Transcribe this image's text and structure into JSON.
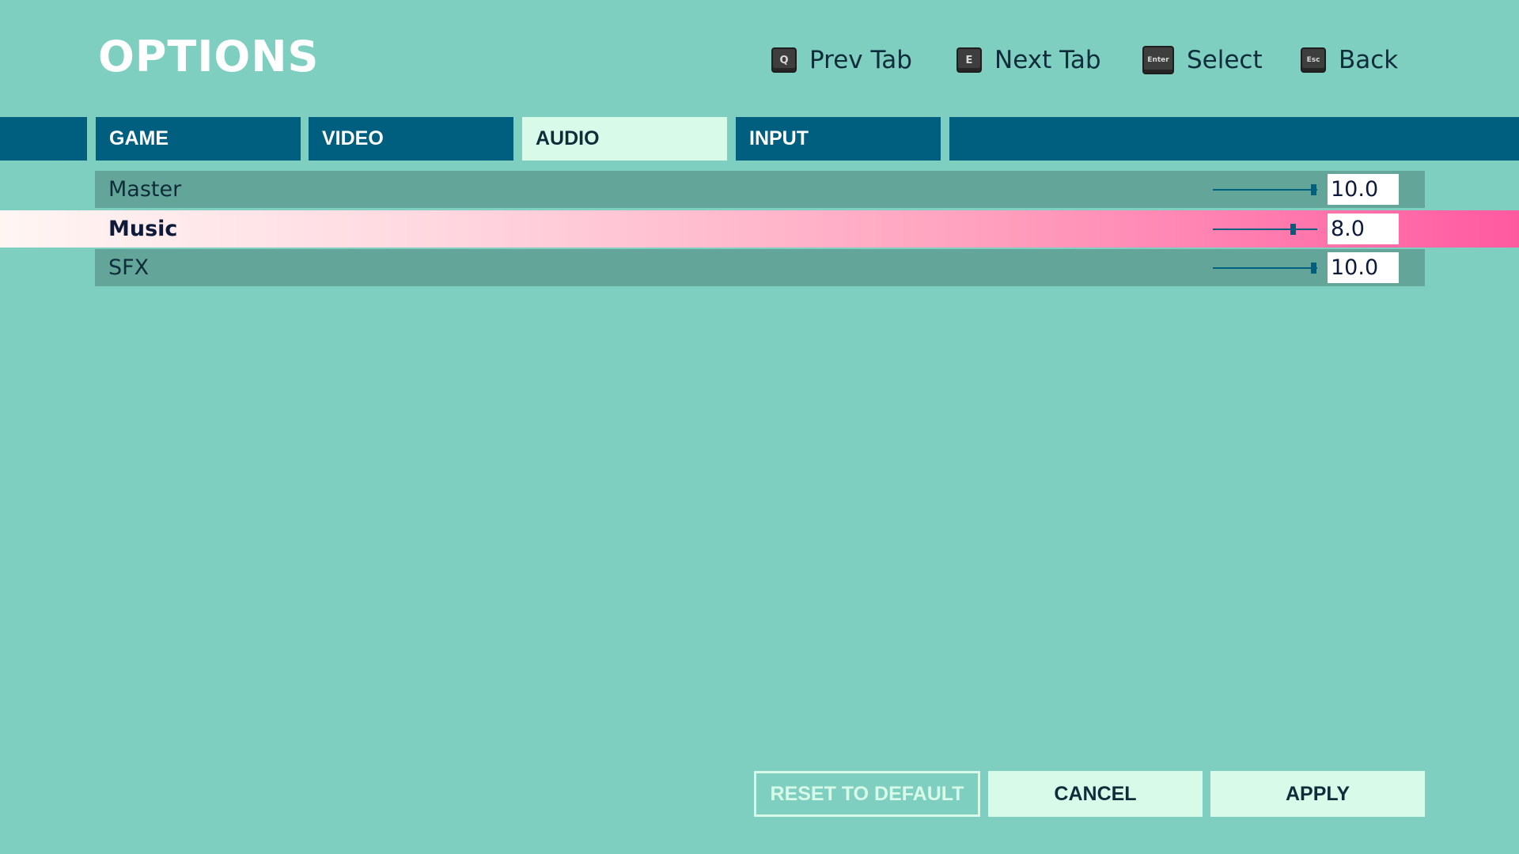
{
  "header": {
    "title": "OPTIONS"
  },
  "hints": [
    {
      "key": "Q",
      "label": "Prev Tab",
      "icon": "q-key-icon"
    },
    {
      "key": "E",
      "label": "Next Tab",
      "icon": "e-key-icon"
    },
    {
      "key": "Enter",
      "label": "Select",
      "icon": "enter-key-icon"
    },
    {
      "key": "Esc",
      "label": "Back",
      "icon": "esc-key-icon"
    }
  ],
  "tabs": [
    {
      "label": "GAME",
      "active": false
    },
    {
      "label": "VIDEO",
      "active": false
    },
    {
      "label": "AUDIO",
      "active": true
    },
    {
      "label": "INPUT",
      "active": false
    }
  ],
  "settings": [
    {
      "label": "Master",
      "value": "10.0",
      "level": 1.0,
      "selected": false
    },
    {
      "label": "Music",
      "value": "8.0",
      "level": 0.8,
      "selected": true
    },
    {
      "label": "SFX",
      "value": "10.0",
      "level": 1.0,
      "selected": false
    }
  ],
  "buttons": {
    "reset": "RESET TO DEFAULT",
    "cancel": "CANCEL",
    "apply": "APPLY"
  },
  "colors": {
    "background": "#7ecfc0",
    "tab": "#005e7f",
    "tab_active": "#d8fbe9",
    "row": "#64a59a",
    "highlight_end": "#ff5aa0",
    "button": "#d8fbe9"
  }
}
